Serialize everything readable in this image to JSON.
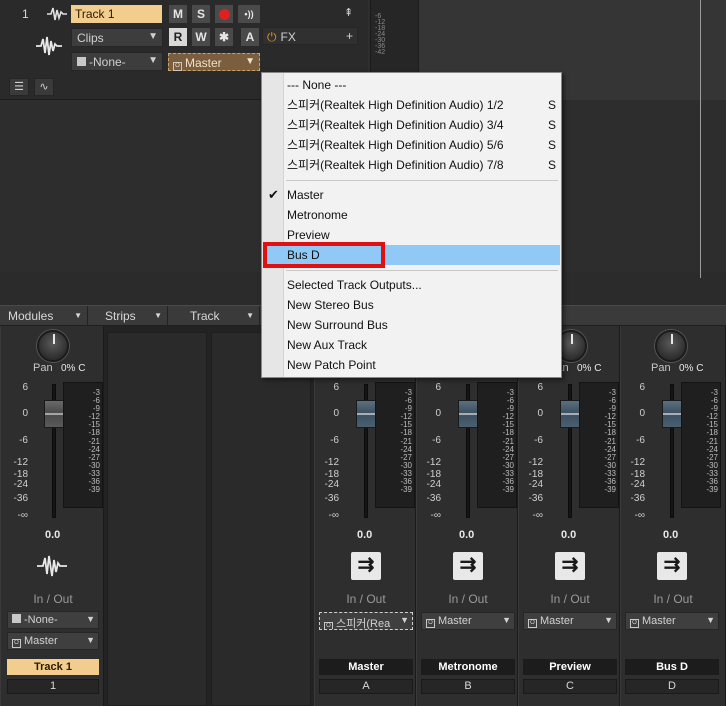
{
  "track": {
    "number": "1",
    "name": "Track 1",
    "clips_dropdown": "Clips",
    "input_dropdown": "-None-",
    "output_dropdown": "Master",
    "buttons": {
      "mute": "M",
      "solo": "S",
      "read": "R",
      "write": "W",
      "star": "✱",
      "a": "A"
    },
    "fx_label": "FX",
    "fx_add": "+",
    "meter_scale": [
      "-6",
      "-12",
      "-18",
      "-24",
      "-30",
      "-36",
      "-42"
    ]
  },
  "context_menu": {
    "items": [
      {
        "label": "--- None ---",
        "shortcut": ""
      },
      {
        "label": "스피커(Realtek High Definition Audio) 1/2",
        "shortcut": "S"
      },
      {
        "label": "스피커(Realtek High Definition Audio) 3/4",
        "shortcut": "S"
      },
      {
        "label": "스피커(Realtek High Definition Audio) 5/6",
        "shortcut": "S"
      },
      {
        "label": "스피커(Realtek High Definition Audio) 7/8",
        "shortcut": "S"
      },
      {
        "label": "Master",
        "shortcut": "",
        "checked": true
      },
      {
        "label": "Metronome",
        "shortcut": ""
      },
      {
        "label": "Preview",
        "shortcut": ""
      },
      {
        "label": "Bus D",
        "shortcut": "",
        "highlighted": true
      },
      {
        "label": "Selected Track Outputs...",
        "shortcut": ""
      },
      {
        "label": "New Stereo Bus",
        "shortcut": ""
      },
      {
        "label": "New Surround Bus",
        "shortcut": ""
      },
      {
        "label": "New Aux Track",
        "shortcut": ""
      },
      {
        "label": "New Patch Point",
        "shortcut": ""
      }
    ],
    "check_glyph": "✔"
  },
  "console_bar": {
    "modules": "Modules",
    "strips": "Strips",
    "track": "Track"
  },
  "strips": {
    "pan_label": "Pan",
    "pan_value": "0% C",
    "fader_scale": [
      "6",
      "0",
      "-6",
      "-12",
      "-18",
      "-24",
      "-36",
      "-∞"
    ],
    "meter_scale": [
      "-3",
      "-6",
      "-9",
      "-12",
      "-15",
      "-18",
      "-21",
      "-24",
      "-27",
      "-30",
      "-33",
      "-36",
      "-39"
    ],
    "volume": "0.0",
    "io_label": "In / Out",
    "track_strip": {
      "input": "-None-",
      "output": "Master",
      "name": "Track 1",
      "number": "1"
    },
    "buses": [
      {
        "output": "스피커(Rea",
        "name": "Master",
        "letter": "A"
      },
      {
        "output": "Master",
        "name": "Metronome",
        "letter": "B"
      },
      {
        "output": "Master",
        "name": "Preview",
        "letter": "C"
      },
      {
        "output": "Master",
        "name": "Bus D",
        "letter": "D"
      }
    ],
    "bus_icon_glyph": "⇉"
  },
  "colors": {
    "track_name_bg": "#f3cd8d",
    "menu_highlight": "#90c8f6",
    "annotation_box": "#e01010",
    "output_active_bg": "#7a5e3e"
  }
}
